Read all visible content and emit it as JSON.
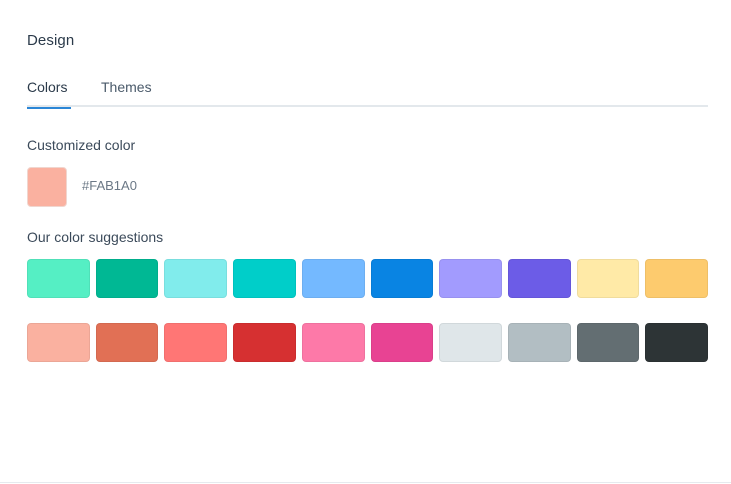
{
  "header": {
    "title": "Design"
  },
  "tabs": [
    {
      "label": "Colors",
      "active": true
    },
    {
      "label": "Themes",
      "active": false
    }
  ],
  "custom": {
    "label": "Customized color",
    "hex": "#FAB1A0",
    "color": "#FAB1A0"
  },
  "suggestions": {
    "label": "Our color suggestions",
    "rows": [
      [
        "#55EFC4",
        "#00B894",
        "#81ECEC",
        "#00CEC9",
        "#74B9FF",
        "#0984E3",
        "#A29BFE",
        "#6C5CE7",
        "#FFEAA7",
        "#FDCB6E"
      ],
      [
        "#FAB1A0",
        "#E17055",
        "#FF7675",
        "#D63031",
        "#FD79A8",
        "#E84393",
        "#DFE6E9",
        "#B2BEC3",
        "#636E72",
        "#2D3436"
      ]
    ]
  }
}
